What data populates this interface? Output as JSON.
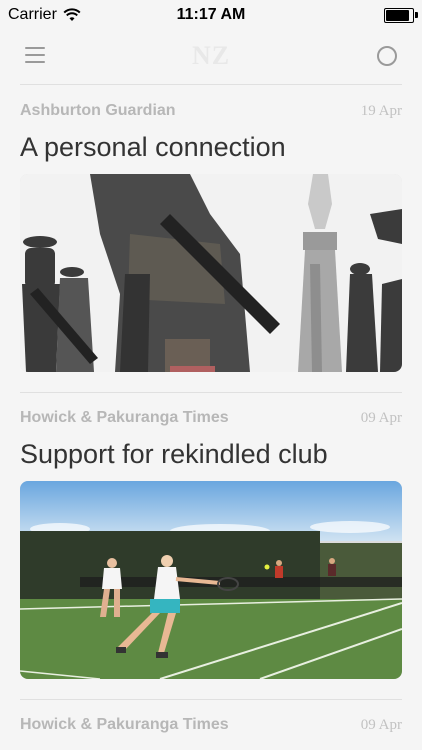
{
  "status_bar": {
    "carrier": "Carrier",
    "time": "11:17 AM",
    "battery_level": 0.95
  },
  "nav": {
    "logo": "NZ",
    "left_icon": "hamburger-menu",
    "right_icon": "circle-outline"
  },
  "articles": [
    {
      "source": "Ashburton Guardian",
      "date": "19 Apr",
      "headline": "A personal connection",
      "image_subject": "soldiers-and-war-memorial-photo"
    },
    {
      "source": "Howick & Pakuranga Times",
      "date": "09 Apr",
      "headline": "Support for rekindled club",
      "image_subject": "tennis-doubles-on-grass-court-photo"
    },
    {
      "source": "Howick & Pakuranga Times",
      "date": "09 Apr"
    }
  ],
  "colors": {
    "background": "#f5f5f5",
    "source_text": "#b7b7b7",
    "headline_text": "#333333",
    "icon_gray": "#9a9a9a"
  }
}
